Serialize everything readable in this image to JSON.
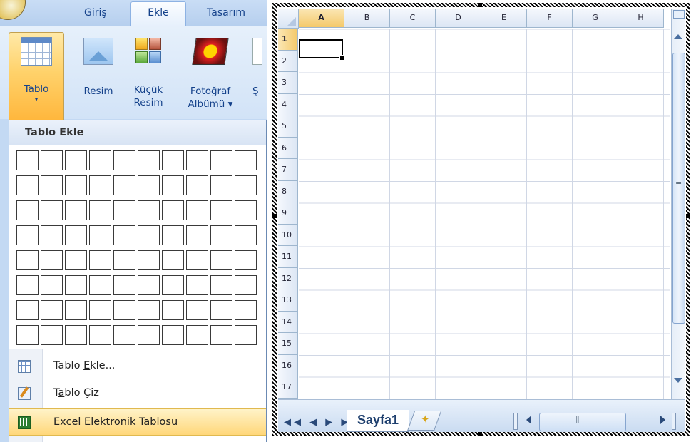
{
  "ribbon": {
    "tabs": [
      "Giriş",
      "Ekle",
      "Tasarım"
    ],
    "active_tab": "Ekle",
    "buttons": {
      "tablo": {
        "label": "Tablo",
        "arrow": "▾"
      },
      "resim": {
        "label": "Resim"
      },
      "kucuk_resim": {
        "line1": "Küçük",
        "line2": "Resim"
      },
      "fotograf_albumu": {
        "line1": "Fotoğraf",
        "line2": "Albümü ▾"
      },
      "truncated": {
        "label": "Ş"
      }
    }
  },
  "dropdown": {
    "header": "Tablo Ekle",
    "grid": {
      "columns": 10,
      "rows": 8
    },
    "items": [
      {
        "pre": "Tablo ",
        "accel": "E",
        "post": "kle...",
        "icon": "table-insert-icon"
      },
      {
        "pre": "T",
        "accel": "a",
        "post": "blo Çiz",
        "icon": "pencil-draw-icon"
      },
      {
        "pre": "E",
        "accel": "x",
        "post": "cel Elektronik Tablosu",
        "icon": "excel-sheet-icon",
        "highlighted": true
      }
    ]
  },
  "excel": {
    "columns": [
      "A",
      "B",
      "C",
      "D",
      "E",
      "F",
      "G",
      "H"
    ],
    "rows": [
      "1",
      "2",
      "3",
      "4",
      "5",
      "6",
      "7",
      "8",
      "9",
      "10",
      "11",
      "12",
      "13",
      "14",
      "15",
      "16",
      "17"
    ],
    "active_cell": "A1",
    "sheet_tab": "Sayfa1",
    "nav_arrows": "◀◀ ◀ ▶ ▶▶"
  },
  "colors": {
    "highlight": "#ffd77a",
    "ribbon_blue": "#c3d9f3",
    "label_blue": "#15428b"
  }
}
